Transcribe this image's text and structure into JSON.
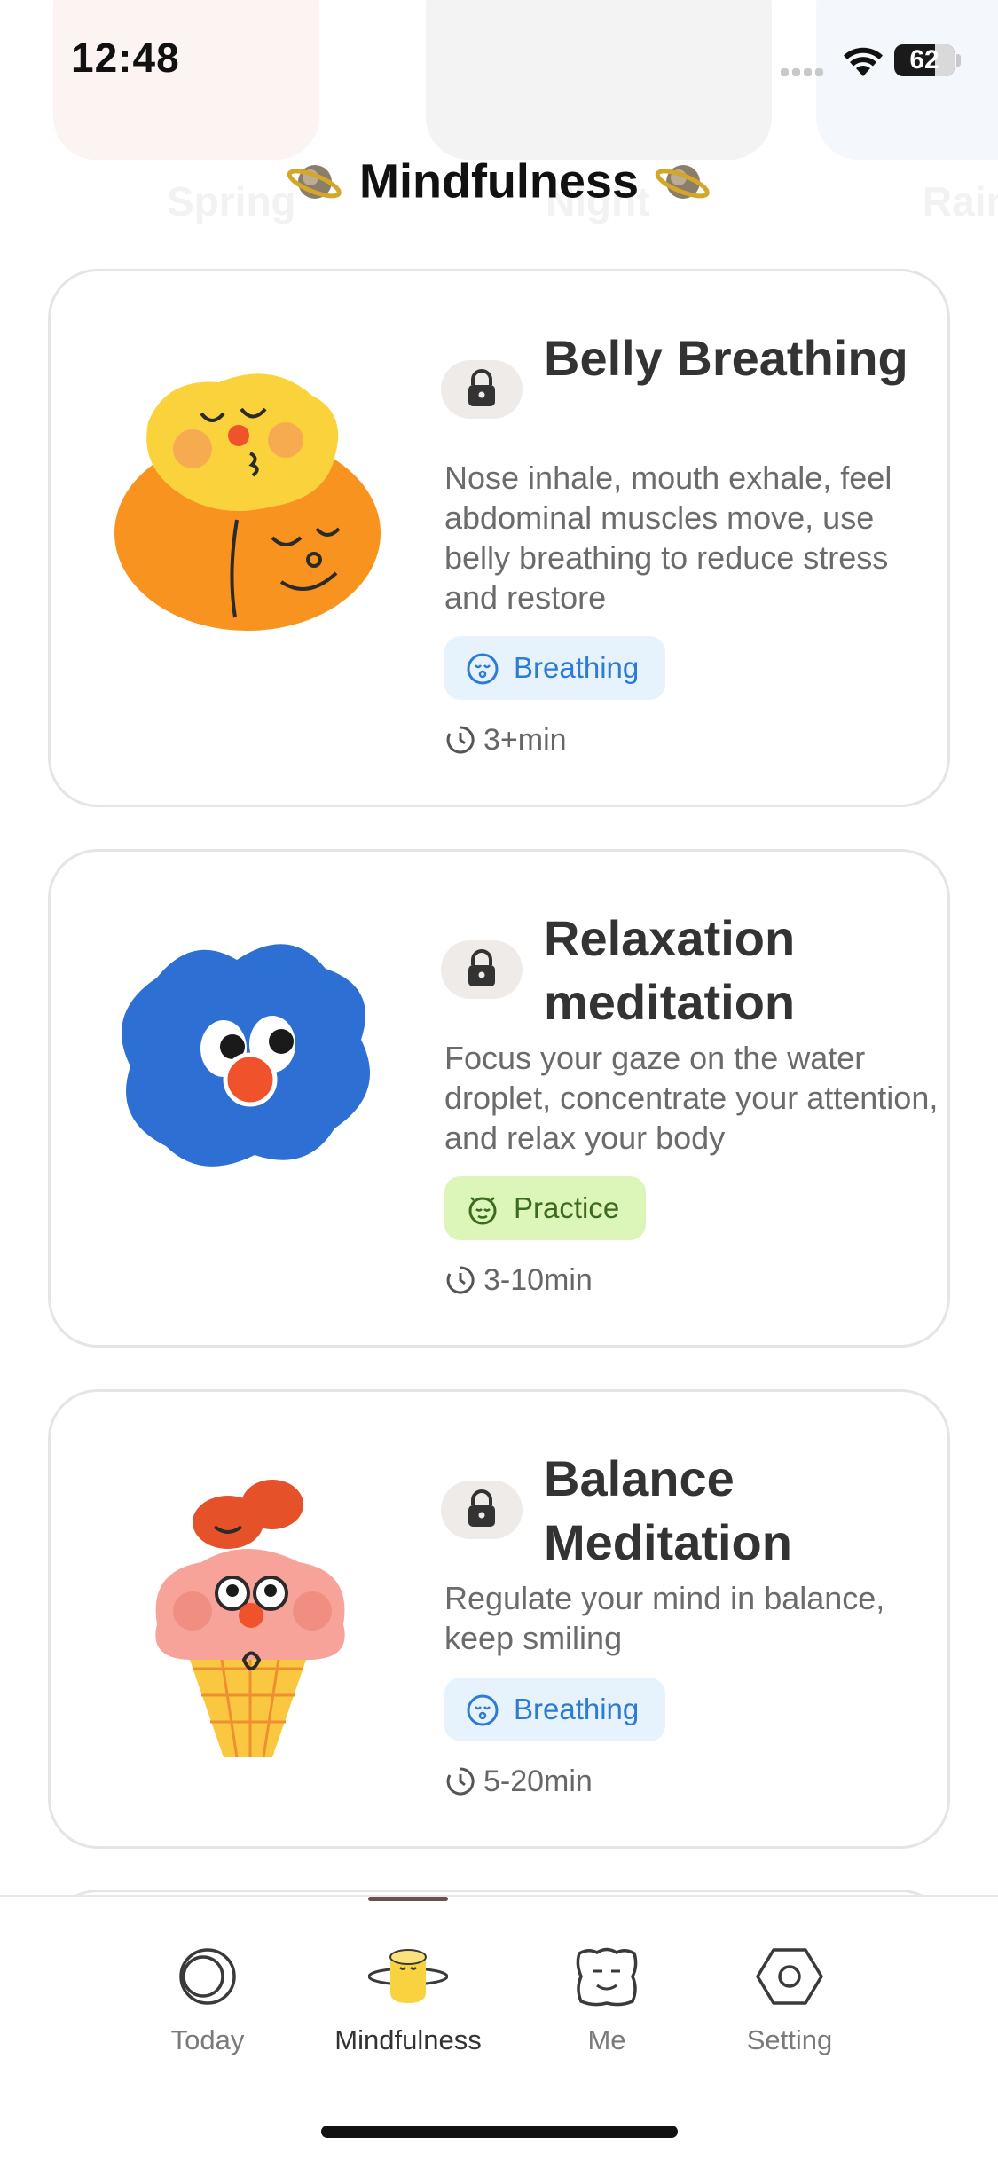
{
  "status_bar": {
    "time": "12:48",
    "battery": "62"
  },
  "background_words": [
    "Spring",
    "Night",
    "Rain"
  ],
  "header": {
    "title": "Mindfulness"
  },
  "cards": [
    {
      "title": "Belly Breathing",
      "description": "Nose inhale, mouth exhale, feel abdominal muscles move, use belly breathing to reduce stress and restore",
      "tag": "Breathing",
      "tag_color": "#2d7bd4",
      "duration": "3+min",
      "locked": true
    },
    {
      "title": "Relaxation meditation",
      "description": "Focus your gaze on the water droplet, concentrate your attention, and relax your body",
      "tag": "Practice",
      "tag_color": "#3c6b1e",
      "duration": "3-10min",
      "locked": true
    },
    {
      "title": "Balance Meditation",
      "description": "Regulate your mind in balance, keep smiling",
      "tag": "Breathing",
      "tag_color": "#2d7bd4",
      "duration": "5-20min",
      "locked": true
    }
  ],
  "tab_bar": {
    "items": [
      {
        "label": "Today",
        "icon": "moon-circle-icon",
        "active": false
      },
      {
        "label": "Mindfulness",
        "icon": "bun-halo-icon",
        "active": true
      },
      {
        "label": "Me",
        "icon": "face-square-icon",
        "active": false
      },
      {
        "label": "Setting",
        "icon": "hexagon-nut-icon",
        "active": false
      }
    ]
  }
}
